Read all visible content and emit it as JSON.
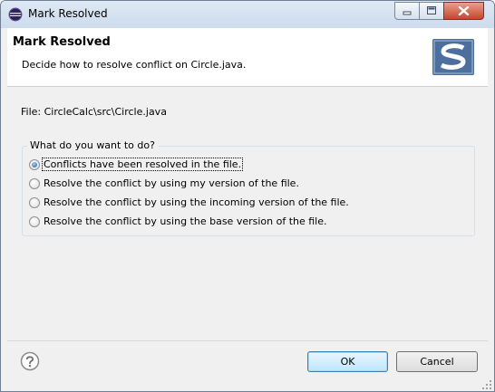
{
  "window": {
    "title": "Mark Resolved"
  },
  "header": {
    "title": "Mark Resolved",
    "description": "Decide how to resolve conflict on Circle.java."
  },
  "file_label": "File: CircleCalc\\src\\Circle.java",
  "group": {
    "legend": "What do you want to do?",
    "options": [
      {
        "label": "Conflicts have been resolved in the file.",
        "selected": true
      },
      {
        "label": "Resolve the conflict by using my version of the file.",
        "selected": false
      },
      {
        "label": "Resolve the conflict by using the incoming version of the file.",
        "selected": false
      },
      {
        "label": "Resolve the conflict by using the base version of the file.",
        "selected": false
      }
    ]
  },
  "buttons": {
    "ok": "OK",
    "cancel": "Cancel"
  },
  "icons": {
    "app": "eclipse-icon",
    "header_logo": "subversive-logo-icon",
    "help": "help-icon"
  },
  "colors": {
    "accent": "#3c7fb1",
    "selection_dot": "#1a5aa8",
    "close_button": "#c6452d"
  }
}
